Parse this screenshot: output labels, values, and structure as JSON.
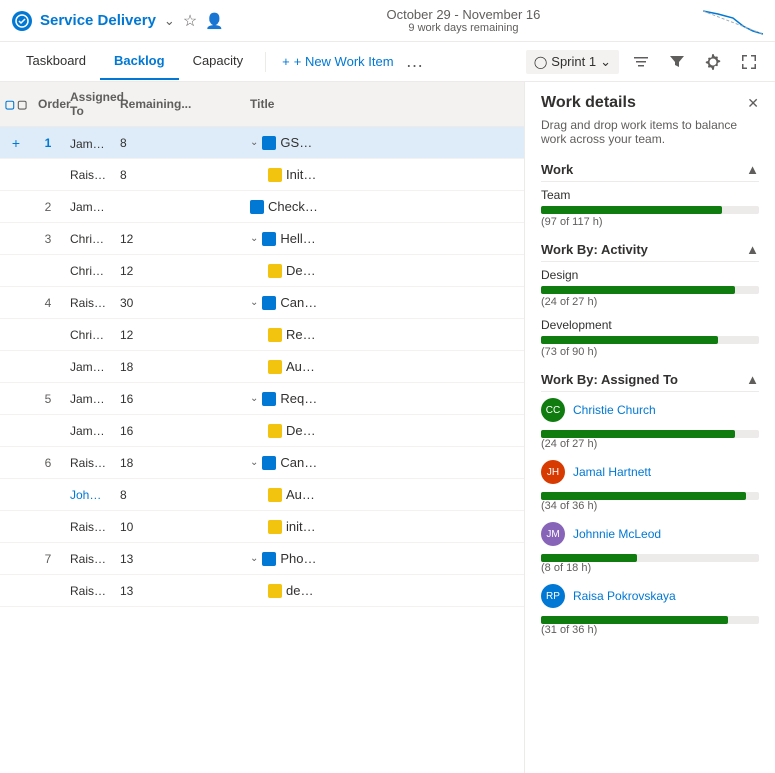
{
  "topBar": {
    "projectName": "Service Delivery",
    "sprintDates": "October 29 - November 16",
    "sprintRemaining": "9 work days remaining"
  },
  "navTabs": {
    "tabs": [
      "Taskboard",
      "Backlog",
      "Capacity"
    ],
    "activeTab": "Backlog",
    "newWorkItemLabel": "+ New Work Item",
    "sprintLabel": "Sprint 1"
  },
  "tableHeaders": {
    "add": "+",
    "check": "",
    "order": "Order",
    "assignedTo": "Assigned To",
    "remaining": "Remaining...",
    "title": "Title"
  },
  "rows": [
    {
      "order": "1",
      "assignedTo": "Jamal Hartnett",
      "remaining": "8",
      "title": "GSP locator interface",
      "type": "story",
      "indent": 0,
      "highlight": true,
      "hasChevron": true,
      "dots": true,
      "orderBlue": true,
      "assigneeLink": false
    },
    {
      "order": "",
      "assignedTo": "Raisa Pokrovskaya",
      "remaining": "8",
      "title": "Initial design",
      "type": "task",
      "indent": 1,
      "highlight": false,
      "hasChevron": false,
      "dots": false,
      "orderBlue": false,
      "assigneeLink": false
    },
    {
      "order": "2",
      "assignedTo": "Jamal Hartnett",
      "remaining": "",
      "title": "Check service status",
      "type": "story",
      "indent": 0,
      "highlight": false,
      "hasChevron": false,
      "dots": false,
      "orderBlue": false,
      "assigneeLink": false
    },
    {
      "order": "3",
      "assignedTo": "Christie Church",
      "remaining": "12",
      "title": "Hello World Web Site",
      "type": "story",
      "indent": 0,
      "highlight": false,
      "hasChevron": true,
      "dots": false,
      "orderBlue": false,
      "assigneeLink": false
    },
    {
      "order": "",
      "assignedTo": "Christie Church",
      "remaining": "12",
      "title": "Design welcome screen",
      "type": "task",
      "indent": 1,
      "highlight": false,
      "hasChevron": false,
      "dots": false,
      "orderBlue": false,
      "assigneeLink": false
    },
    {
      "order": "4",
      "assignedTo": "Raisa Pokrovskaya",
      "remaining": "30",
      "title": "Cancel order form",
      "type": "story",
      "indent": 0,
      "highlight": false,
      "hasChevron": true,
      "dots": false,
      "orderBlue": false,
      "assigneeLink": false
    },
    {
      "order": "",
      "assignedTo": "Christie Church",
      "remaining": "12",
      "title": "Research slow response ti...",
      "type": "task",
      "indent": 1,
      "highlight": false,
      "hasChevron": false,
      "dots": false,
      "orderBlue": false,
      "assigneeLink": false
    },
    {
      "order": "",
      "assignedTo": "Jamal Hartnett",
      "remaining": "18",
      "title": "Auto-save",
      "type": "task",
      "indent": 1,
      "highlight": false,
      "hasChevron": false,
      "dots": false,
      "orderBlue": false,
      "assigneeLink": false
    },
    {
      "order": "5",
      "assignedTo": "Jamal Hartnett",
      "remaining": "16",
      "title": "Request support",
      "type": "story",
      "indent": 0,
      "highlight": false,
      "hasChevron": true,
      "dots": false,
      "orderBlue": false,
      "assigneeLink": false
    },
    {
      "order": "",
      "assignedTo": "Jamal Hartnett",
      "remaining": "16",
      "title": "Develop form",
      "type": "task",
      "indent": 1,
      "highlight": false,
      "hasChevron": false,
      "dots": false,
      "orderBlue": false,
      "assigneeLink": false
    },
    {
      "order": "6",
      "assignedTo": "Raisa Pokrovskaya",
      "remaining": "18",
      "title": "Cancel order form",
      "type": "story",
      "indent": 0,
      "highlight": false,
      "hasChevron": true,
      "dots": false,
      "orderBlue": false,
      "assigneeLink": false
    },
    {
      "order": "",
      "assignedTo": "Johnnie McLeod",
      "remaining": "8",
      "title": "Auto-complete user's na...",
      "type": "task",
      "indent": 1,
      "highlight": false,
      "hasChevron": false,
      "dots": false,
      "orderBlue": false,
      "assigneeLink": true
    },
    {
      "order": "",
      "assignedTo": "Raisa Pokrovskaya",
      "remaining": "10",
      "title": "initial work",
      "type": "task",
      "indent": 1,
      "highlight": false,
      "hasChevron": false,
      "dots": false,
      "orderBlue": false,
      "assigneeLink": false
    },
    {
      "order": "7",
      "assignedTo": "Raisa Pokrovskaya",
      "remaining": "13",
      "title": "Phone sign in",
      "type": "story",
      "indent": 0,
      "highlight": false,
      "hasChevron": true,
      "dots": false,
      "orderBlue": false,
      "assigneeLink": false
    },
    {
      "order": "",
      "assignedTo": "Raisa Pokrovskaya",
      "remaining": "13",
      "title": "development work",
      "type": "task",
      "indent": 1,
      "highlight": false,
      "hasChevron": false,
      "dots": false,
      "orderBlue": false,
      "assigneeLink": false
    }
  ],
  "workDetails": {
    "title": "Work details",
    "subtitle": "Drag and drop work items to balance work across your team.",
    "sections": {
      "work": {
        "label": "Work",
        "team": {
          "label": "Team",
          "current": 97,
          "total": 117,
          "text": "(97 of 117 h)",
          "percent": 83
        }
      },
      "workByActivity": {
        "label": "Work By: Activity",
        "activities": [
          {
            "name": "Design",
            "current": 24,
            "total": 27,
            "text": "(24 of 27 h)",
            "percent": 89
          },
          {
            "name": "Development",
            "current": 73,
            "total": 90,
            "text": "(73 of 90 h)",
            "percent": 81
          }
        ]
      },
      "workByAssignedTo": {
        "label": "Work By: Assigned To",
        "people": [
          {
            "name": "Christie Church",
            "current": 24,
            "total": 27,
            "text": "(24 of 27 h)",
            "percent": 89,
            "avatarColor": "green",
            "initials": "CC"
          },
          {
            "name": "Jamal Hartnett",
            "current": 34,
            "total": 36,
            "text": "(34 of 36 h)",
            "percent": 94,
            "avatarColor": "orange",
            "initials": "JH"
          },
          {
            "name": "Johnnie McLeod",
            "current": 8,
            "total": 18,
            "text": "(8 of 18 h)",
            "percent": 44,
            "avatarColor": "purple",
            "initials": "JM"
          },
          {
            "name": "Raisa Pokrovskaya",
            "current": 31,
            "total": 36,
            "text": "(31 of 36 h)",
            "percent": 86,
            "avatarColor": "blue",
            "initials": "RP"
          }
        ]
      }
    }
  }
}
